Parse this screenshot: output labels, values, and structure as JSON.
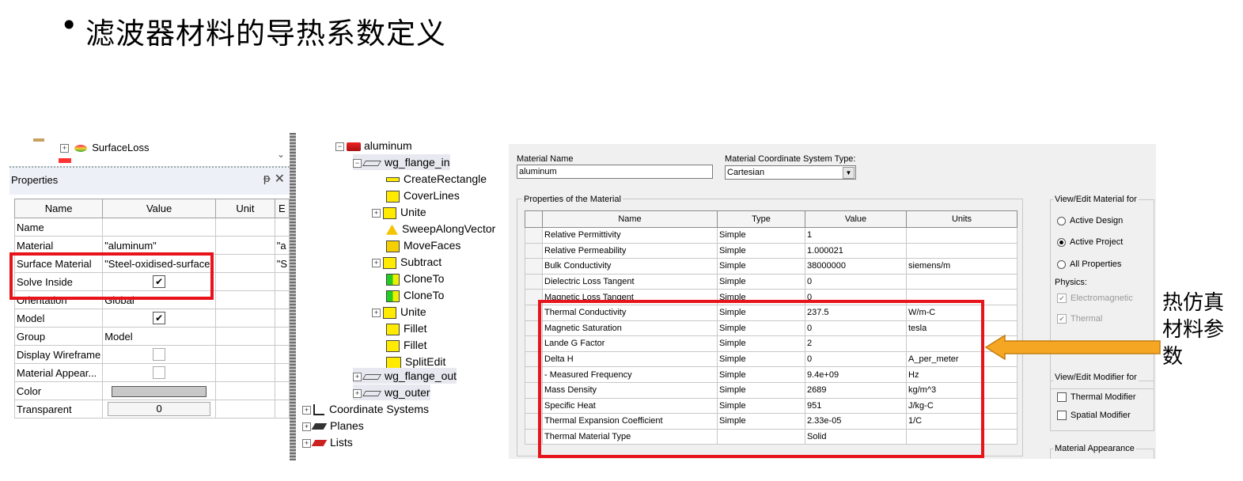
{
  "slide": {
    "bullet": "•",
    "title": "滤波器材料的导热系数定义",
    "note": "热仿真材料参数"
  },
  "properties_panel": {
    "tree_fragment": {
      "item": "SurfaceLoss"
    },
    "header": "Properties",
    "pin_glyph": "ᵽ",
    "close_glyph": "✕",
    "columns": [
      "Name",
      "Value",
      "Unit",
      "E"
    ],
    "rows": [
      {
        "name": "Name",
        "value": "",
        "unit": "",
        "e": ""
      },
      {
        "name": "Material",
        "value": "\"aluminum\"",
        "unit": "",
        "e": "\"a"
      },
      {
        "name": "Surface Material",
        "value": "\"Steel-oxidised-surface\"",
        "unit": "",
        "e": "\"S"
      },
      {
        "name": "Solve Inside",
        "value": "",
        "checkbox": true,
        "checked": true
      },
      {
        "name": "Orientation",
        "value": "Global",
        "unit": "",
        "e": ""
      },
      {
        "name": "Model",
        "value": "",
        "checkbox": true,
        "checked": true
      },
      {
        "name": "Group",
        "value": "Model",
        "unit": "",
        "e": ""
      },
      {
        "name": "Display Wireframe",
        "value": "",
        "checkbox": true,
        "checked": false
      },
      {
        "name": "Material Appear...",
        "value": "",
        "checkbox": true,
        "checked": false
      },
      {
        "name": "Color",
        "value": "",
        "swatch": "#c8c8c8"
      },
      {
        "name": "Transparent",
        "value": "0"
      }
    ]
  },
  "model_tree": {
    "root": "aluminum",
    "flange_in": "wg_flange_in",
    "ops": [
      "CreateRectangle",
      "CoverLines",
      "Unite",
      "SweepAlongVector",
      "MoveFaces",
      "Subtract",
      "CloneTo",
      "CloneTo",
      "Unite",
      "Fillet",
      "Fillet",
      "SplitEdit"
    ],
    "flange_out": "wg_flange_out",
    "outer": "wg_outer",
    "coord": "Coordinate Systems",
    "planes": "Planes",
    "lists": "Lists"
  },
  "material_dialog": {
    "material_name_label": "Material Name",
    "material_name_value": "aluminum",
    "coord_type_label": "Material Coordinate System Type:",
    "coord_type_value": "Cartesian",
    "props_group": "Properties of the Material",
    "columns": [
      "Name",
      "Type",
      "Value",
      "Units"
    ],
    "rows": [
      [
        "Relative Permittivity",
        "Simple",
        "1",
        ""
      ],
      [
        "Relative Permeability",
        "Simple",
        "1.000021",
        ""
      ],
      [
        "Bulk Conductivity",
        "Simple",
        "38000000",
        "siemens/m"
      ],
      [
        "Dielectric Loss Tangent",
        "Simple",
        "0",
        ""
      ],
      [
        "Magnetic Loss Tangent",
        "Simple",
        "0",
        ""
      ],
      [
        "Thermal Conductivity",
        "Simple",
        "237.5",
        "W/m-C"
      ],
      [
        "Magnetic Saturation",
        "Simple",
        "0",
        "tesla"
      ],
      [
        "Lande G Factor",
        "Simple",
        "2",
        ""
      ],
      [
        "Delta H",
        "Simple",
        "0",
        "A_per_meter"
      ],
      [
        "- Measured Frequency",
        "Simple",
        "9.4e+09",
        "Hz"
      ],
      [
        "Mass Density",
        "Simple",
        "2689",
        "kg/m^3"
      ],
      [
        "Specific Heat",
        "Simple",
        "951",
        "J/kg-C"
      ],
      [
        "Thermal Expansion Coefficient",
        "Simple",
        "2.33e-05",
        "1/C"
      ],
      [
        "Thermal Material Type",
        "",
        "Solid",
        ""
      ]
    ],
    "view_edit_group": "View/Edit Material for",
    "radios": [
      {
        "label": "Active Design",
        "selected": false
      },
      {
        "label": "Active Project",
        "selected": true
      },
      {
        "label": "All Properties",
        "selected": false
      }
    ],
    "physics_label": "Physics:",
    "physics": [
      {
        "label": "Electromagnetic",
        "checked": true
      },
      {
        "label": "Thermal",
        "checked": true
      }
    ],
    "modifier_group": "View/Edit Modifier for",
    "modifiers": [
      {
        "label": "Thermal Modifier",
        "checked": false
      },
      {
        "label": "Spatial Modifier",
        "checked": false
      }
    ],
    "appearance_group": "Material Appearance"
  },
  "colors": {
    "highlight": "#e8141c",
    "arrow": "#f5a623",
    "arrow_stroke": "#c47d10"
  }
}
